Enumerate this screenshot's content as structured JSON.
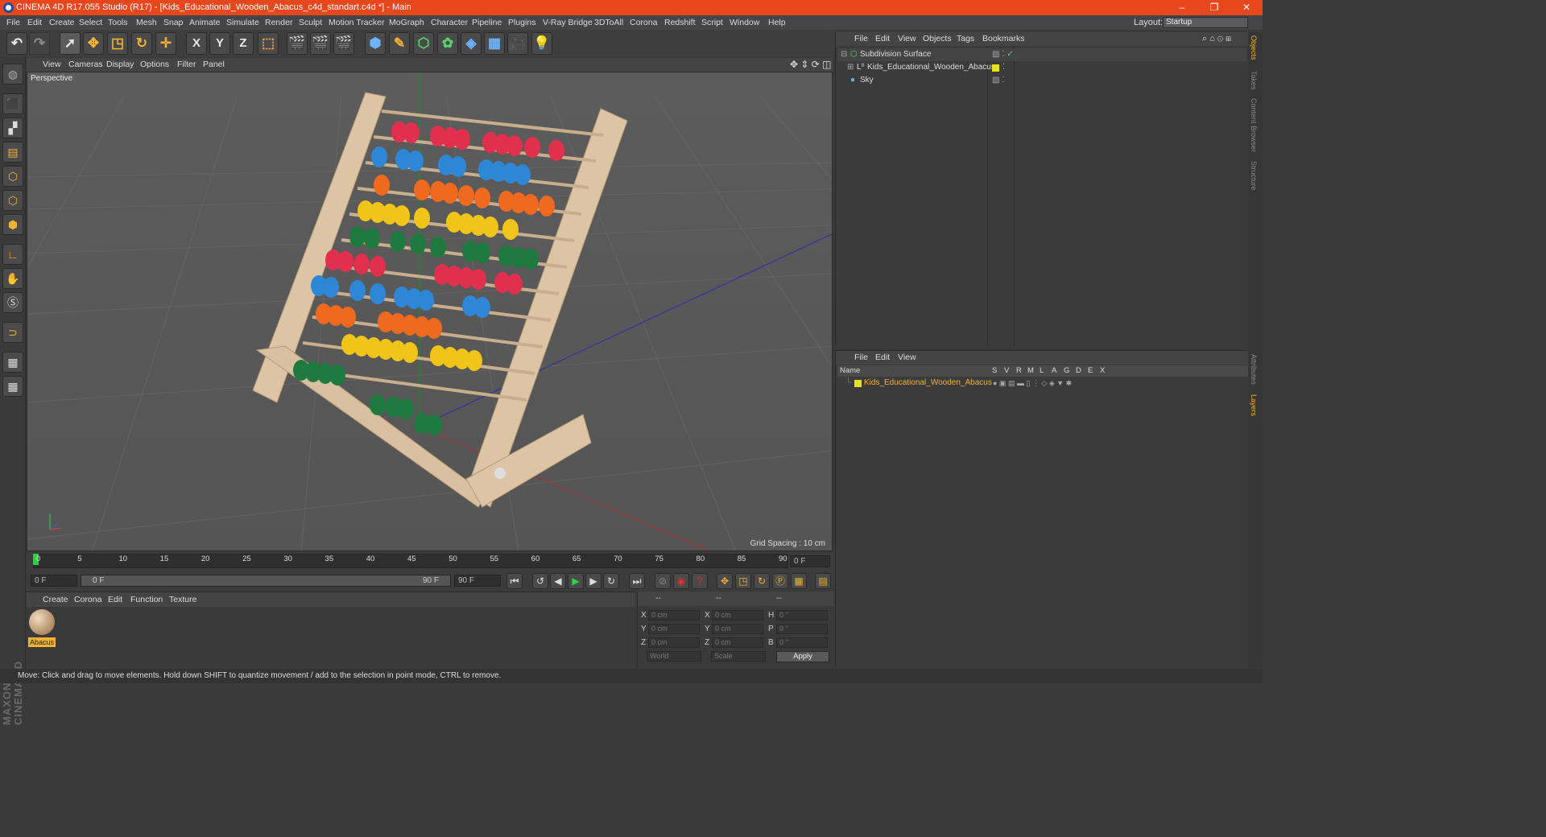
{
  "window": {
    "title": "CINEMA 4D R17.055 Studio (R17) - [Kids_Educational_Wooden_Abacus_c4d_standart.c4d *] - Main",
    "controls": [
      "–",
      "❐",
      "✕"
    ]
  },
  "menubar": {
    "items": [
      "File",
      "Edit",
      "Create",
      "Select",
      "Tools",
      "Mesh",
      "Snap",
      "Animate",
      "Simulate",
      "Render",
      "Sculpt",
      "Motion Tracker",
      "MoGraph",
      "Character",
      "Pipeline",
      "Plugins",
      "V-Ray Bridge",
      "3DToAll",
      "Corona",
      "Redshift",
      "Script",
      "Window",
      "Help"
    ],
    "layout_label": "Layout:",
    "layout_value": "Startup"
  },
  "toolbar": {
    "axis": [
      "X",
      "Y",
      "Z"
    ]
  },
  "viewport": {
    "menu": [
      "View",
      "Cameras",
      "Display",
      "Options",
      "Filter",
      "Panel"
    ],
    "camera_label": "Perspective",
    "grid_spacing": "Grid Spacing : 10 cm"
  },
  "timeline": {
    "ticks": [
      "0",
      "5",
      "10",
      "15",
      "20",
      "25",
      "30",
      "35",
      "40",
      "45",
      "50",
      "55",
      "60",
      "65",
      "70",
      "75",
      "80",
      "85",
      "90"
    ],
    "current_frame": "0 F",
    "start_field": "0 F",
    "range_start": "0 F",
    "range_end": "90 F",
    "end_field": "90 F"
  },
  "material_panel": {
    "menu": [
      "Create",
      "Corona",
      "Edit",
      "Function",
      "Texture"
    ],
    "materials": [
      {
        "name": "Abacus"
      }
    ]
  },
  "coord_panel": {
    "headers": [
      "--",
      "--",
      "--"
    ],
    "rows": [
      {
        "a": "X",
        "av": "0 cm",
        "b": "X",
        "bv": "0 cm",
        "c": "H",
        "cv": "0 °"
      },
      {
        "a": "Y",
        "av": "0 cm",
        "b": "Y",
        "bv": "0 cm",
        "c": "P",
        "cv": "0 °"
      },
      {
        "a": "Z",
        "av": "0 cm",
        "b": "Z",
        "bv": "0 cm",
        "c": "B",
        "cv": "0 °"
      }
    ],
    "space": "World",
    "mode": "Scale",
    "apply": "Apply"
  },
  "object_manager": {
    "menu": [
      "File",
      "Edit",
      "View",
      "Objects",
      "Tags",
      "Bookmarks"
    ],
    "objects": [
      "Subdivision Surface",
      "Kids_Educational_Wooden_Abacus",
      "Sky"
    ]
  },
  "layer_manager": {
    "menu": [
      "File",
      "Edit",
      "View"
    ],
    "columns": [
      "Name",
      "S",
      "V",
      "R",
      "M",
      "L",
      "A",
      "G",
      "D",
      "E",
      "X"
    ],
    "layers": [
      "Kids_Educational_Wooden_Abacus"
    ]
  },
  "side_tabs": [
    "Objects",
    "Takes",
    "Content Browser",
    "Structure",
    "Attributes",
    "Layers"
  ],
  "status": "Move: Click and drag to move elements. Hold down SHIFT to quantize movement / add to the selection in point mode, CTRL to remove.",
  "brand": "MAXON CINEMA 4D"
}
